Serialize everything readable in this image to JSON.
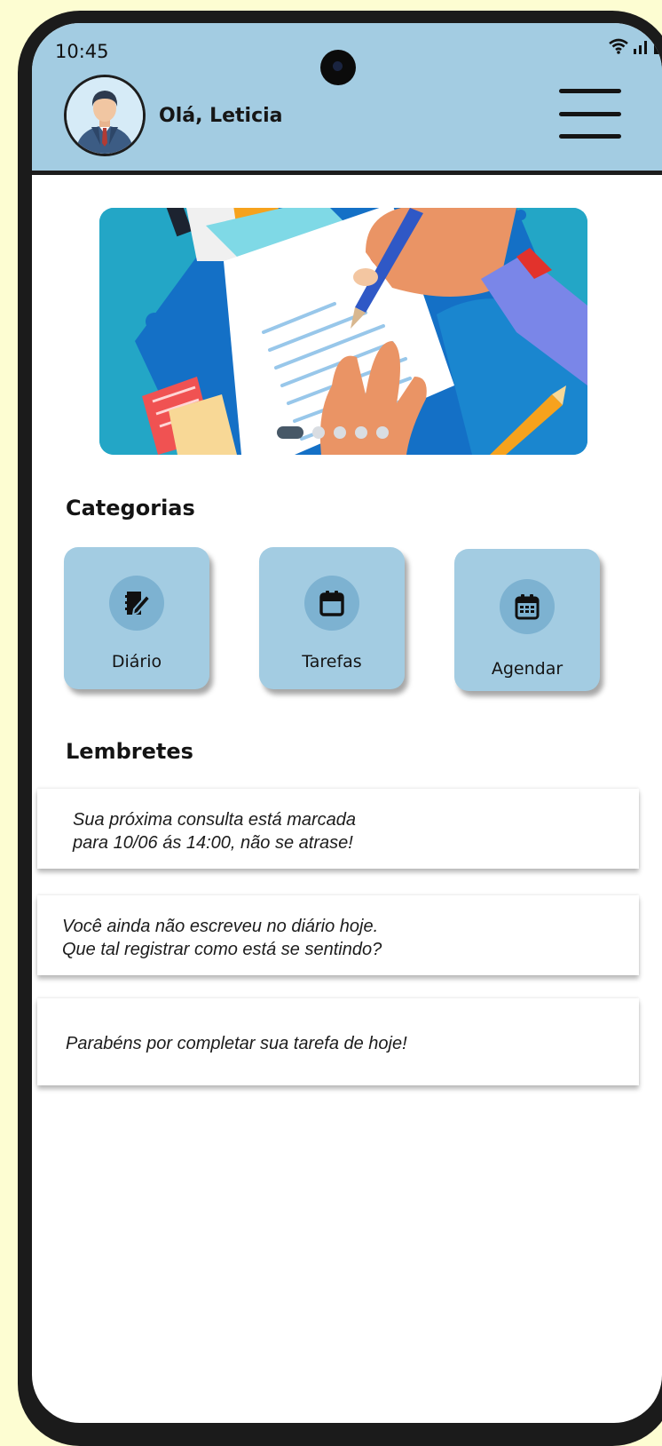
{
  "status_bar": {
    "time": "10:45",
    "icons": [
      "wifi-icon",
      "signal-icon",
      "battery-icon"
    ]
  },
  "header": {
    "greeting": "Olá, Leticia",
    "avatar_icon": "user-avatar",
    "menu_icon": "hamburger-menu-icon"
  },
  "banner": {
    "image": "writing-journal-illustration",
    "slide_count": 5,
    "active_slide": 1
  },
  "categories": {
    "title": "Categorias",
    "items": [
      {
        "label": "Diário",
        "icon": "journal-icon"
      },
      {
        "label": "Tarefas",
        "icon": "calendar-task-icon"
      },
      {
        "label": "Agendar",
        "icon": "calendar-schedule-icon"
      }
    ]
  },
  "reminders": {
    "title": "Lembretes",
    "items": [
      {
        "text": "Sua próxima consulta está marcada\npara 10/06 ás 14:00, não se atrase!"
      },
      {
        "text": "Você ainda não escreveu no diário hoje.\nQue tal registrar como está se sentindo?"
      },
      {
        "text": "Parabéns por completar sua tarefa de hoje!"
      }
    ]
  },
  "colors": {
    "background": "#fdfdd2",
    "header": "#a3cce2",
    "card": "#a3cce2",
    "icon_circle": "#7db2d1",
    "frame": "#1b1b1b"
  }
}
